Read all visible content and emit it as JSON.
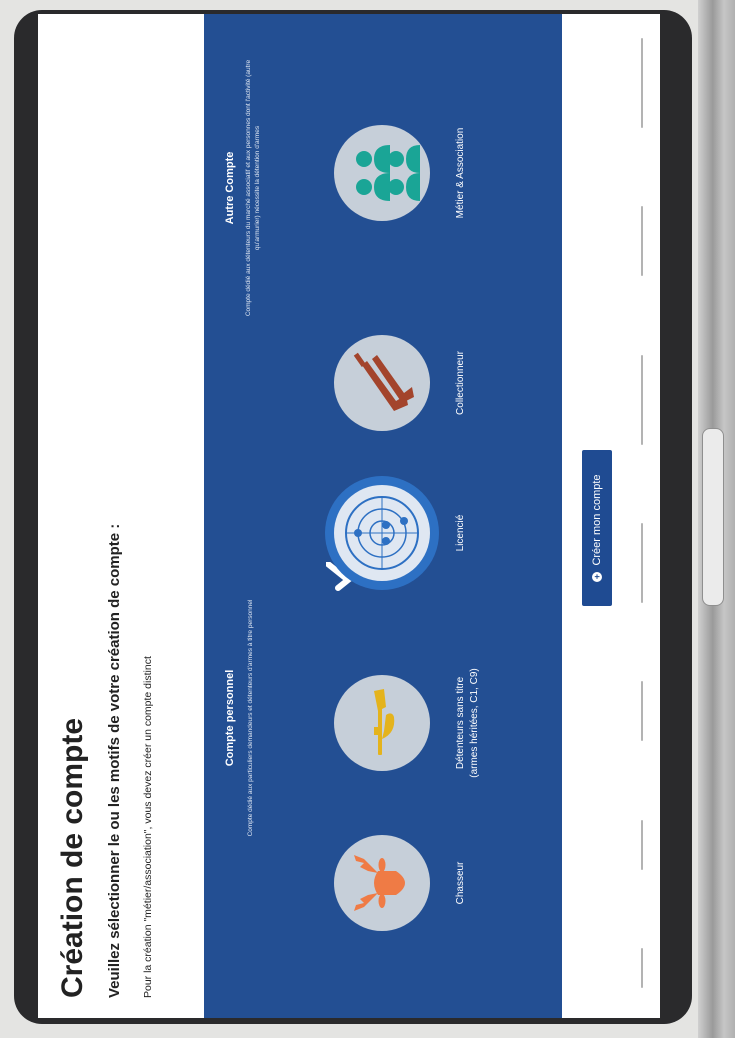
{
  "page": {
    "title": "Création de compte",
    "subtitle": "Veuillez sélectionner le ou les motifs de votre création de compte :",
    "note": "Pour la création \"métier/association\", vous devez créer un compte distinct"
  },
  "groups": {
    "personal": {
      "title": "Compte personnel",
      "description": "Compte dédié aux particuliers demandeurs et détenteurs d'armes à titre personnel"
    },
    "other": {
      "title": "Autre Compte",
      "description": "Compte dédié aux détenteurs du marché associatif et aux personnes dont l'activité (autre qu'armurier) nécessite la détention d'armes"
    }
  },
  "options": [
    {
      "label": "Chasseur",
      "icon": "elk-head-icon",
      "color": "#ef7b45"
    },
    {
      "label_line1": "Détenteurs sans titre",
      "label_line2": "(armes héritées, C1, C9)",
      "icon": "rifle-hand-icon",
      "color": "#e4b31c"
    },
    {
      "label": "Licencié",
      "icon": "target-icon",
      "selected": true,
      "color": "#2d70c3"
    },
    {
      "label": "Collectionneur",
      "icon": "antique-guns-icon",
      "color": "#a3442c"
    },
    {
      "label": "Métier & Association",
      "icon": "people-group-icon",
      "color": "#1aa596"
    }
  ],
  "actions": {
    "create_label": "Créer mon compte"
  },
  "colors": {
    "panel": "#234f93",
    "button": "#1f4b92",
    "circle": "#c6cfd9"
  }
}
